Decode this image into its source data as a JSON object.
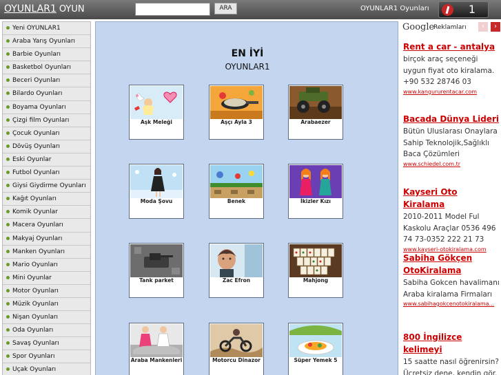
{
  "header": {
    "logo_main": "OYUNLAR1",
    "logo_sub": "OYUN",
    "search_value": "",
    "search_button": "ARA",
    "site_link": "OYUNLAR1 Oyunları",
    "like_count": "1",
    "like_icon": "facebook-like-icon"
  },
  "sidebar": {
    "items": [
      "Yeni OYUNLAR1",
      "Araba Yarış Oyunları",
      "Barbie Oyunları",
      "Basketbol Oyunları",
      "Beceri Oyunları",
      "Bilardo Oyunları",
      "Boyama Oyunları",
      "Çizgi film Oyunları",
      "Çocuk Oyunları",
      "Dövüş Oyunları",
      "Eski Oyunlar",
      "Futbol Oyunları",
      "Giysi Giydirme Oyunları",
      "Kağıt Oyunları",
      "Komik Oyunlar",
      "Macera Oyunları",
      "Makyaj Oyunları",
      "Manken Oyunları",
      "Mario Oyunları",
      "Mini Oyunlar",
      "Motor Oyunları",
      "Müzik Oyunları",
      "Nişan Oyunları",
      "Oda Oyunları",
      "Savaş Oyunları",
      "Spor Oyunları",
      "Uçak Oyunları"
    ]
  },
  "main": {
    "heading1": "EN İYİ",
    "heading2": "OYUNLAR1",
    "games": [
      {
        "label": "Aşk Meleği",
        "thumb": "cupid-thumbnail"
      },
      {
        "label": "Aşçı Ayla 3",
        "thumb": "cooking-thumbnail"
      },
      {
        "label": "Arabaezer",
        "thumb": "monster-truck-thumbnail"
      },
      {
        "label": "Moda Şovu",
        "thumb": "fashion-show-thumbnail"
      },
      {
        "label": "Benek",
        "thumb": "platformer-thumbnail"
      },
      {
        "label": "İkizler Kızı",
        "thumb": "twin-girls-thumbnail"
      },
      {
        "label": "Tank parket",
        "thumb": "tank-parking-thumbnail"
      },
      {
        "label": "Zac Efron",
        "thumb": "celebrity-thumbnail"
      },
      {
        "label": "Mahjong",
        "thumb": "mahjong-thumbnail"
      },
      {
        "label": "Araba Mankenleri",
        "thumb": "car-models-thumbnail"
      },
      {
        "label": "Motorcu Dinazor",
        "thumb": "motocross-thumbnail"
      },
      {
        "label": "Süper Yemek 5",
        "thumb": "food-thumbnail"
      }
    ]
  },
  "ads": {
    "provider": "Google",
    "provider_sub": "Reklamları",
    "prev_icon": "chevron-left-icon",
    "next_icon": "chevron-right-icon",
    "items": [
      {
        "title": "Rent a car - antalya",
        "desc": "birçok araç seçeneği uygun fiyat oto kiralama. +90 532 28746 03",
        "url": "www.kangururentacar.com"
      },
      {
        "title": "Bacada Dünya Lideri",
        "desc": "Bütün Uluslarası Onaylara Sahip Teknolojik,Sağlıklı Baca Çözümleri",
        "url": "www.schiedel.com.tr"
      },
      {
        "title": "Kayseri Oto Kiralama",
        "desc": "2010-2011 Model Ful Kaskolu Araçlar 0536 496 74 73-0352 222 21 73",
        "url": "www.kayseri-otokiralama.com"
      },
      {
        "title": "Sabiha Gökçen OtoKiralama",
        "desc": "Sabiha Gokcen havalimanı Araba kiralama Firmaları",
        "url": "www.sabihagokcenotokiralama..."
      },
      {
        "title": "800 İngilizce kelimeyi",
        "desc": "15 saatte nasıl öğrenirsin? Ücretsiz dene, kendin gör.",
        "url": ""
      }
    ]
  },
  "colors": {
    "header_bg": "#5a5a5a",
    "sidebar_bg": "#e9e9e9",
    "main_bg": "#c4d6ef",
    "ad_title": "#cc0000",
    "bullet": "#6a9a2a"
  }
}
